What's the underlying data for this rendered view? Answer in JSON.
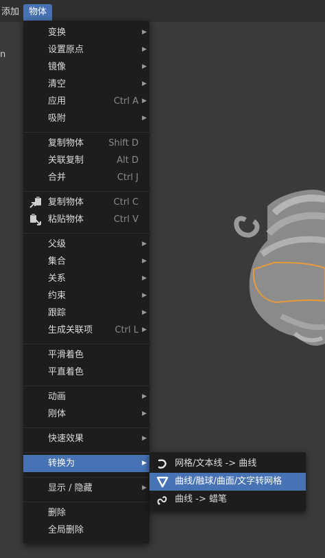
{
  "header": {
    "add_label": "添加",
    "object_label": "物体"
  },
  "side_text": "n",
  "menu": {
    "items": [
      {
        "label": "变换",
        "shortcut": "",
        "submenu": true
      },
      {
        "label": "设置原点",
        "shortcut": "",
        "submenu": true
      },
      {
        "label": "镜像",
        "shortcut": "",
        "submenu": true
      },
      {
        "label": "清空",
        "shortcut": "",
        "submenu": true
      },
      {
        "label": "应用",
        "shortcut": "Ctrl A",
        "submenu": true
      },
      {
        "label": "吸附",
        "shortcut": "",
        "submenu": true
      },
      {
        "label": "复制物体",
        "shortcut": "Shift D",
        "submenu": false
      },
      {
        "label": "关联复制",
        "shortcut": "Alt D",
        "submenu": false
      },
      {
        "label": "合并",
        "shortcut": "Ctrl J",
        "submenu": false
      },
      {
        "label": "复制物体",
        "shortcut": "Ctrl C",
        "submenu": false,
        "icon": "copy-icon"
      },
      {
        "label": "粘贴物体",
        "shortcut": "Ctrl V",
        "submenu": false,
        "icon": "paste-icon"
      },
      {
        "label": "父级",
        "shortcut": "",
        "submenu": true
      },
      {
        "label": "集合",
        "shortcut": "",
        "submenu": true
      },
      {
        "label": "关系",
        "shortcut": "",
        "submenu": true
      },
      {
        "label": "约束",
        "shortcut": "",
        "submenu": true
      },
      {
        "label": "跟踪",
        "shortcut": "",
        "submenu": true
      },
      {
        "label": "生成关联项",
        "shortcut": "Ctrl L",
        "submenu": true
      },
      {
        "label": "平滑着色",
        "shortcut": "",
        "submenu": false
      },
      {
        "label": "平直着色",
        "shortcut": "",
        "submenu": false
      },
      {
        "label": "动画",
        "shortcut": "",
        "submenu": true
      },
      {
        "label": "刚体",
        "shortcut": "",
        "submenu": true
      },
      {
        "label": "快速效果",
        "shortcut": "",
        "submenu": true
      },
      {
        "label": "转换为",
        "shortcut": "",
        "submenu": true,
        "highlighted": true
      },
      {
        "label": "显示 / 隐藏",
        "shortcut": "",
        "submenu": true
      },
      {
        "label": "删除",
        "shortcut": "",
        "submenu": false
      },
      {
        "label": "全局删除",
        "shortcut": "",
        "submenu": false
      }
    ]
  },
  "convert_submenu": {
    "items": [
      {
        "label": "网格/文本线 -> 曲线",
        "icon": "curve-icon"
      },
      {
        "label": "曲线/融球/曲面/文字转网格",
        "icon": "mesh-icon",
        "highlighted": true
      },
      {
        "label": "曲线 -> 蜡笔",
        "icon": "grease-pencil-icon"
      }
    ]
  },
  "colors": {
    "accent": "#4772b3",
    "menu_bg": "#1d1d1d",
    "viewport_bg": "#3a3a3a",
    "selection_outline": "#e89a3a"
  }
}
